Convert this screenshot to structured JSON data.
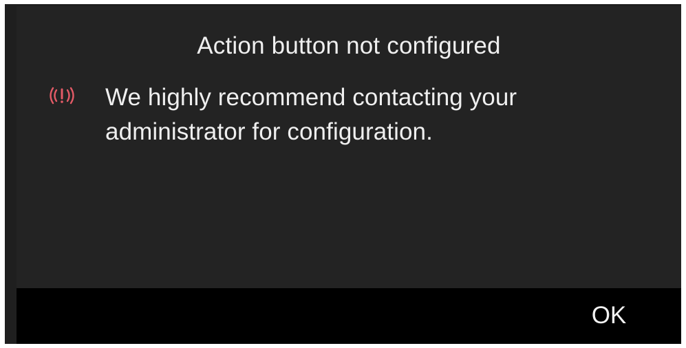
{
  "dialog": {
    "title": "Action button not configured",
    "icon": "alert-icon",
    "message": "We highly recommend contacting your administrator for configuration.",
    "ok_label": "OK"
  },
  "colors": {
    "background": "#232323",
    "footer": "#000000",
    "text": "#efefef",
    "alert": "#e45b67"
  }
}
